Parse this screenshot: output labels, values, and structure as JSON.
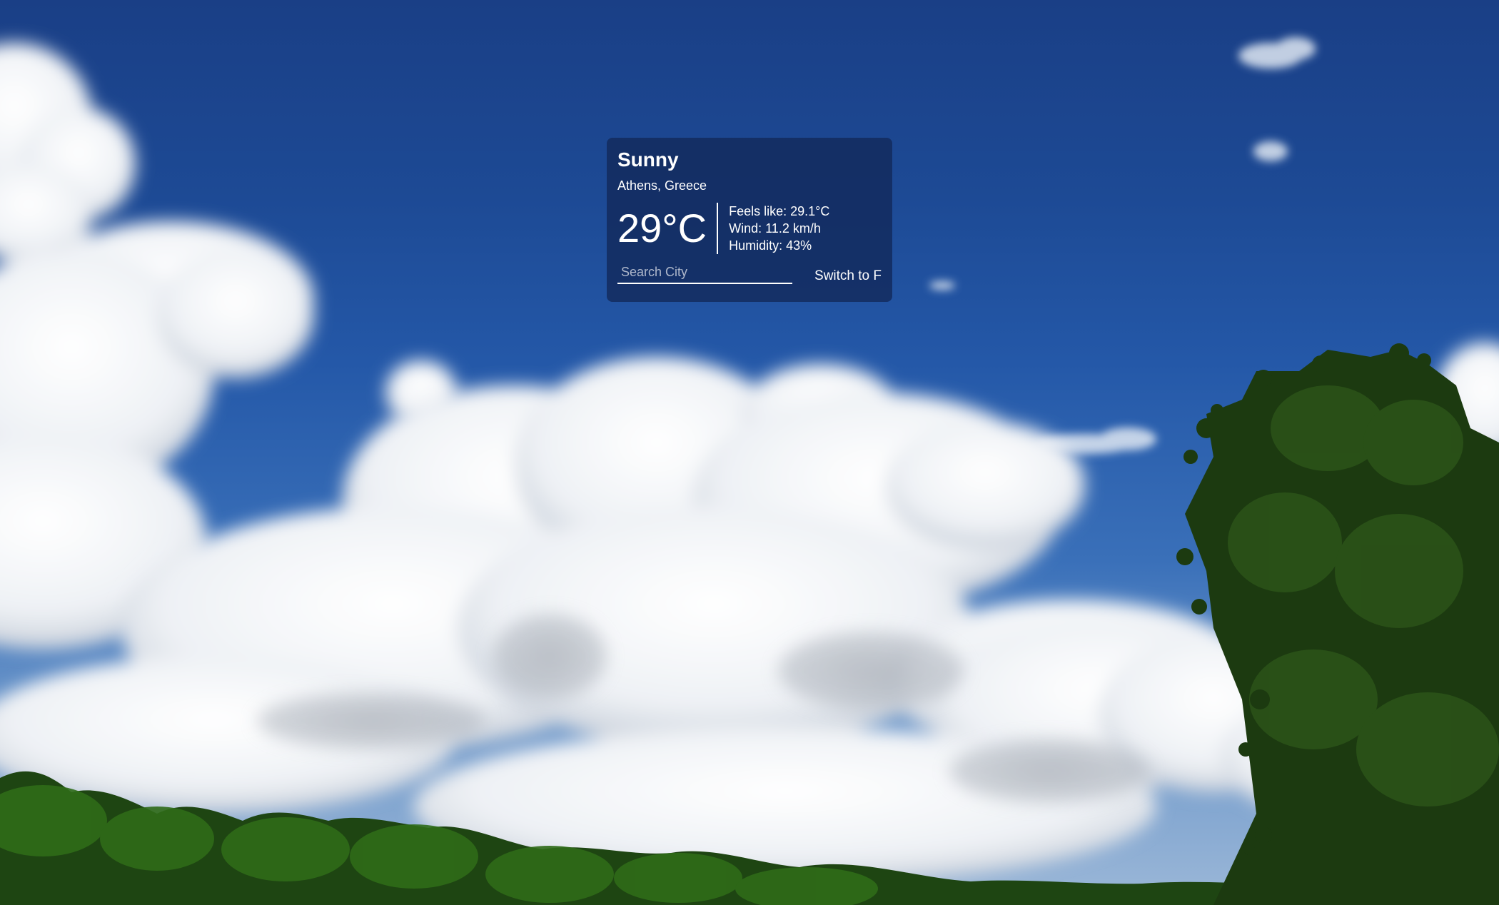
{
  "weather": {
    "condition": "Sunny",
    "location": "Athens, Greece",
    "temperature": "29°C",
    "details": {
      "feels_like": "Feels like: 29.1°C",
      "wind": "Wind: 11.2 km/h",
      "humidity": "Humidity: 43%"
    }
  },
  "search": {
    "placeholder": "Search City",
    "value": ""
  },
  "toggle": {
    "label": "Switch to F"
  },
  "colors": {
    "sky_top": "#1a3f86",
    "sky_bottom": "#9cb8d8",
    "card_background": "#122a5c",
    "text": "#ffffff",
    "foliage": "#1f4a14"
  }
}
